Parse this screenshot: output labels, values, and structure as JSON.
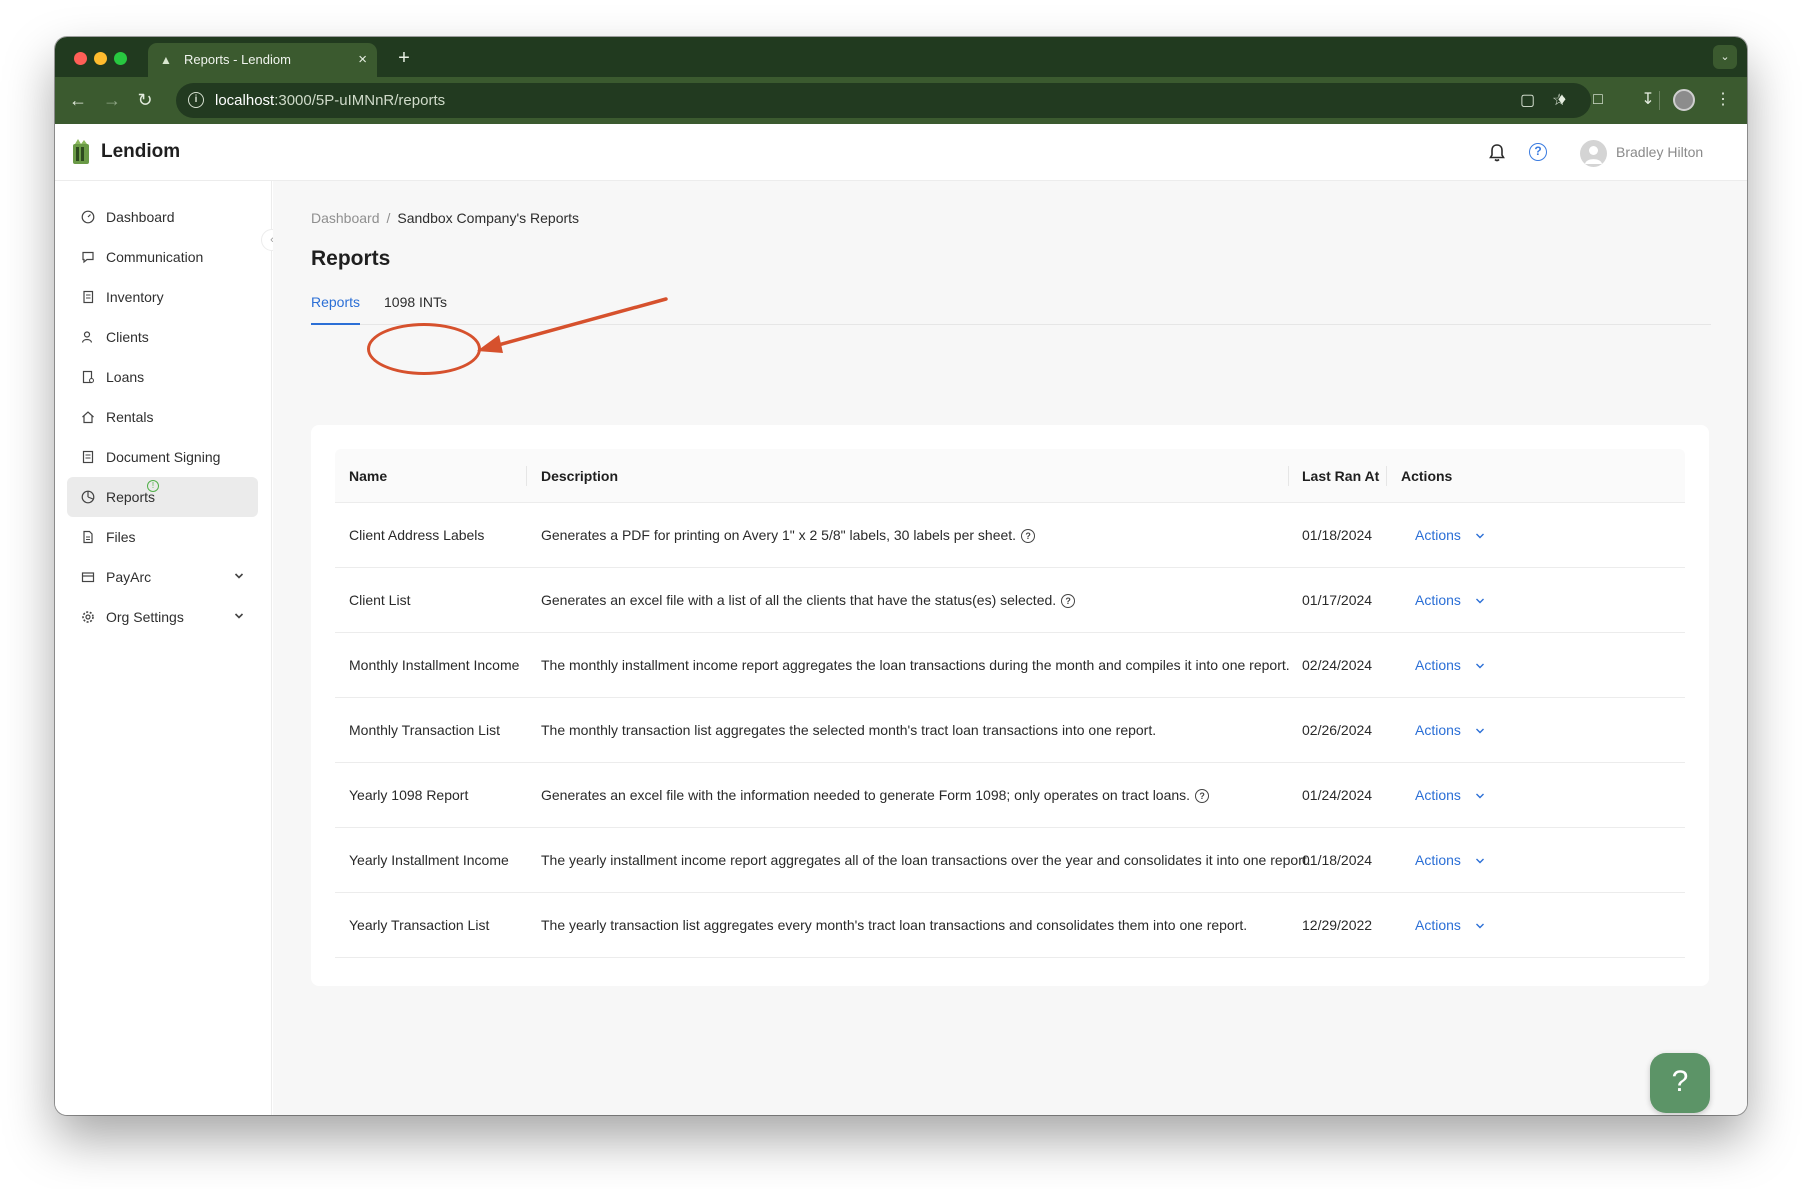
{
  "browser": {
    "tab_title": "Reports - Lendiom",
    "url_host": "localhost",
    "url_path": ":3000/5P-uIMNnR/reports"
  },
  "app": {
    "name": "Lendiom",
    "user_name": "Bradley Hilton"
  },
  "sidebar": {
    "items": [
      {
        "label": "Dashboard",
        "icon": "dashboard-icon"
      },
      {
        "label": "Communication",
        "icon": "chat-icon"
      },
      {
        "label": "Inventory",
        "icon": "inventory-icon"
      },
      {
        "label": "Clients",
        "icon": "clients-icon"
      },
      {
        "label": "Loans",
        "icon": "loans-icon"
      },
      {
        "label": "Rentals",
        "icon": "home-icon"
      },
      {
        "label": "Document Signing",
        "icon": "document-icon"
      },
      {
        "label": "Reports",
        "icon": "reports-icon",
        "active": true
      },
      {
        "label": "Files",
        "icon": "file-icon"
      },
      {
        "label": "PayArc",
        "icon": "card-icon",
        "expandable": true
      },
      {
        "label": "Org Settings",
        "icon": "gear-icon",
        "expandable": true
      }
    ]
  },
  "breadcrumb": {
    "root": "Dashboard",
    "separator": "/",
    "current": "Sandbox Company's Reports"
  },
  "page": {
    "title": "Reports",
    "tabs": [
      "Reports",
      "1098 INTs"
    ]
  },
  "table": {
    "columns": [
      "Name",
      "Description",
      "Last Ran At",
      "Actions"
    ],
    "rows": [
      {
        "name": "Client Address Labels",
        "description": "Generates a PDF for printing on Avery 1\" x 2 5/8\" labels, 30 labels per sheet.",
        "last_ran": "01/18/2024",
        "action": "Actions",
        "help": true
      },
      {
        "name": "Client List",
        "description": "Generates an excel file with a list of all the clients that have the status(es) selected.",
        "last_ran": "01/17/2024",
        "action": "Actions",
        "help": true
      },
      {
        "name": "Monthly Installment Income",
        "description": "The monthly installment income report aggregates the loan transactions during the month and compiles it into one report.",
        "last_ran": "02/24/2024",
        "action": "Actions",
        "help": false
      },
      {
        "name": "Monthly Transaction List",
        "description": "The monthly transaction list aggregates the selected month's tract loan transactions into one report.",
        "last_ran": "02/26/2024",
        "action": "Actions",
        "help": false
      },
      {
        "name": "Yearly 1098 Report",
        "description": "Generates an excel file with the information needed to generate Form 1098; only operates on tract loans.",
        "last_ran": "01/24/2024",
        "action": "Actions",
        "help": true
      },
      {
        "name": "Yearly Installment Income",
        "description": "The yearly installment income report aggregates all of the loan transactions over the year and consolidates it into one report.",
        "last_ran": "01/18/2024",
        "action": "Actions",
        "help": false
      },
      {
        "name": "Yearly Transaction List",
        "description": "The yearly transaction list aggregates every month's tract loan transactions and consolidates them into one report.",
        "last_ran": "12/29/2022",
        "action": "Actions",
        "help": false
      }
    ]
  },
  "fab": {
    "label": "?"
  },
  "colors": {
    "accent": "#2b6fd6",
    "brand_green": "#3b5a2f",
    "fab_green": "#5c9467",
    "annotation": "#d6512d"
  }
}
